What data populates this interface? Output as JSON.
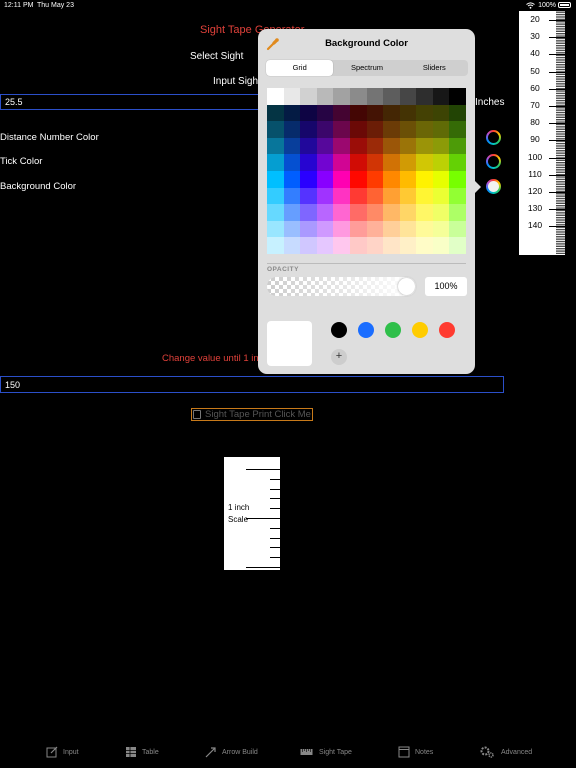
{
  "status_bar": {
    "time": "12:11 PM",
    "date": "Thu May 23",
    "battery": "100%"
  },
  "main": {
    "title": "Sight Tape Generator",
    "select_sight_label": "Select Sight",
    "input_sight_label": "Input Sight",
    "distance_value": "25.5",
    "inches_label": "Inches",
    "color_labels": {
      "distance_number": "Distance Number Color",
      "tick": "Tick Color",
      "background": "Background Color"
    },
    "change_value_text": "Change value until 1 inch",
    "scale_value": "150",
    "print_button_label": "Sight Tape Print Click Me",
    "scale_box_label_line1": "1 inch",
    "scale_box_label_line2": "Scale"
  },
  "tape": {
    "numbers": [
      "20",
      "30",
      "40",
      "50",
      "60",
      "70",
      "80",
      "90",
      "100",
      "110",
      "120",
      "130",
      "140"
    ]
  },
  "color_picker": {
    "title": "Background Color",
    "tabs": [
      "Grid",
      "Spectrum",
      "Sliders"
    ],
    "active_tab": "Grid",
    "opacity_label": "OPACITY",
    "opacity_value": "100%",
    "opacity": 1.0,
    "current_color": "#ffffff",
    "favorites": [
      "#000000",
      "#1a6dff",
      "#2fbf4a",
      "#ffcc00",
      "#ff3b30"
    ],
    "add_favorite_symbol": "+"
  },
  "tabbar": {
    "items": [
      {
        "label": "Input",
        "icon": "edit-icon"
      },
      {
        "label": "Table",
        "icon": "table-icon"
      },
      {
        "label": "Arrow Build",
        "icon": "arrow-icon"
      },
      {
        "label": "Sight Tape",
        "icon": "tape-icon"
      },
      {
        "label": "Notes",
        "icon": "notes-icon"
      },
      {
        "label": "Advanced",
        "icon": "gear-icon"
      }
    ]
  }
}
